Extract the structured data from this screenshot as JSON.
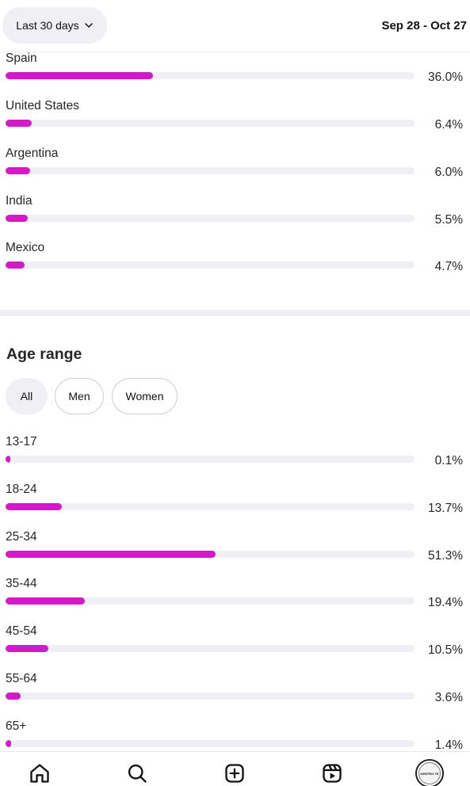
{
  "header": {
    "range_label": "Last 30 days",
    "date_range": "Sep 28 - Oct 27"
  },
  "countries": [
    {
      "name": "Spain",
      "pct": "36.0%",
      "value": 36.0
    },
    {
      "name": "United States",
      "pct": "6.4%",
      "value": 6.4
    },
    {
      "name": "Argentina",
      "pct": "6.0%",
      "value": 6.0
    },
    {
      "name": "India",
      "pct": "5.5%",
      "value": 5.5
    },
    {
      "name": "Mexico",
      "pct": "4.7%",
      "value": 4.7
    }
  ],
  "age": {
    "title": "Age range",
    "filters": [
      "All",
      "Men",
      "Women"
    ],
    "selected_filter": "All",
    "rows": [
      {
        "name": "13-17",
        "pct": "0.1%",
        "value": 0.1
      },
      {
        "name": "18-24",
        "pct": "13.7%",
        "value": 13.7
      },
      {
        "name": "25-34",
        "pct": "51.3%",
        "value": 51.3
      },
      {
        "name": "35-44",
        "pct": "19.4%",
        "value": 19.4
      },
      {
        "name": "45-54",
        "pct": "10.5%",
        "value": 10.5
      },
      {
        "name": "55-64",
        "pct": "3.6%",
        "value": 3.6
      },
      {
        "name": "65+",
        "pct": "1.4%",
        "value": 1.4
      }
    ]
  },
  "nav": {
    "items": [
      "home-icon",
      "search-icon",
      "create-icon",
      "reels-icon",
      "profile-avatar"
    ],
    "avatar_text": "KENTRO TE"
  },
  "colors": {
    "bar_fill": "#d21ac8",
    "bar_track": "#efeff4"
  }
}
